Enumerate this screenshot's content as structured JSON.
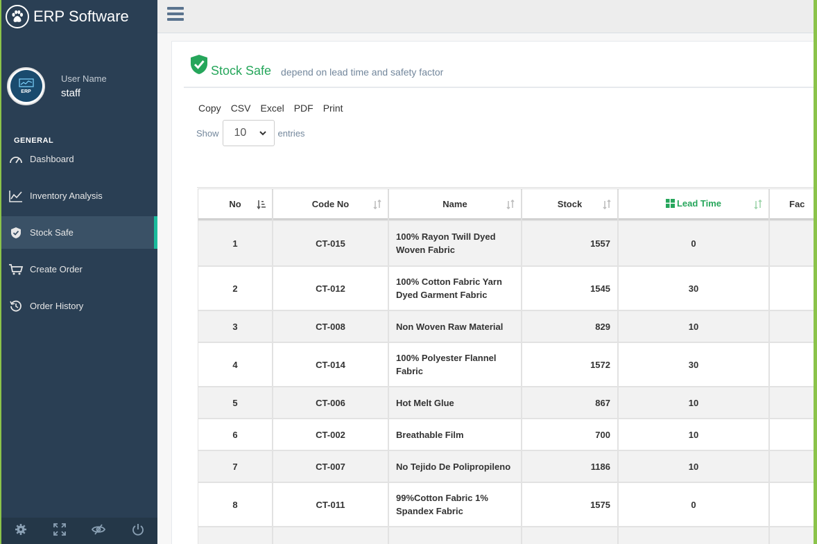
{
  "app": {
    "title": "ERP Software"
  },
  "profile": {
    "label": "User Name",
    "name": "staff",
    "avatar_text": "ERP"
  },
  "sidebar": {
    "section": "GENERAL",
    "items": [
      {
        "label": "Dashboard",
        "icon": "dashboard-gauge-icon",
        "active": false
      },
      {
        "label": "Inventory Analysis",
        "icon": "line-chart-icon",
        "active": false
      },
      {
        "label": "Stock Safe",
        "icon": "shield-check-icon",
        "active": true
      },
      {
        "label": "Create Order",
        "icon": "shopping-cart-icon",
        "active": false
      },
      {
        "label": "Order History",
        "icon": "history-icon",
        "active": false
      }
    ],
    "footer_icons": [
      "settings-icon",
      "fullscreen-icon",
      "hide-eye-icon",
      "power-icon"
    ]
  },
  "page": {
    "title": "Stock Safe",
    "subtitle": "depend on lead time and safety factor"
  },
  "toolbar": {
    "copy": "Copy",
    "csv": "CSV",
    "excel": "Excel",
    "pdf": "PDF",
    "print": "Print"
  },
  "length": {
    "show": "Show",
    "value": "10",
    "entries": "entries"
  },
  "table": {
    "headers": {
      "no": "No",
      "code": "Code No",
      "name": "Name",
      "stock": "Stock",
      "lead": "Lead Time",
      "factor": "Fac"
    },
    "rows": [
      {
        "no": "1",
        "code": "CT-015",
        "name": "100% Rayon Twill Dyed Woven Fabric",
        "stock": "1557",
        "lead": "0"
      },
      {
        "no": "2",
        "code": "CT-012",
        "name": "100% Cotton Fabric Yarn Dyed Garment Fabric",
        "stock": "1545",
        "lead": "30"
      },
      {
        "no": "3",
        "code": "CT-008",
        "name": "Non Woven Raw Material",
        "stock": "829",
        "lead": "10"
      },
      {
        "no": "4",
        "code": "CT-014",
        "name": "100% Polyester Flannel Fabric",
        "stock": "1572",
        "lead": "30"
      },
      {
        "no": "5",
        "code": "CT-006",
        "name": "Hot Melt Glue",
        "stock": "867",
        "lead": "10"
      },
      {
        "no": "6",
        "code": "CT-002",
        "name": "Breathable Film",
        "stock": "700",
        "lead": "10"
      },
      {
        "no": "7",
        "code": "CT-007",
        "name": "No Tejido De Polipropileno",
        "stock": "1186",
        "lead": "10"
      },
      {
        "no": "8",
        "code": "CT-011",
        "name": "99%Cotton Fabric 1% Spandex Fabric",
        "stock": "1575",
        "lead": "0"
      }
    ]
  },
  "colors": {
    "sidebar": "#2a3f54",
    "accent": "#26a65b",
    "active_bar": "#1abb9c"
  }
}
